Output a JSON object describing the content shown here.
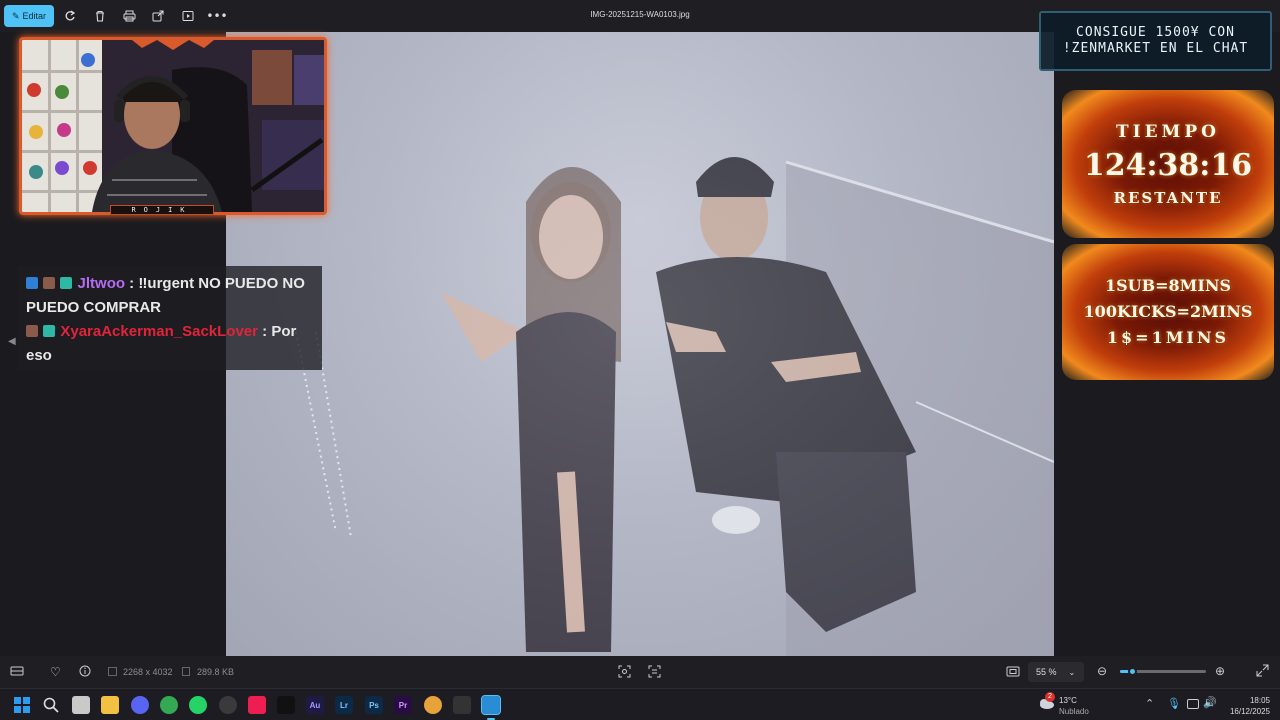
{
  "topbar": {
    "edit_label": "Editar",
    "file_name": "IMG-20251215-WA0103.jpg",
    "icons": [
      "rotate-icon",
      "delete-icon",
      "print-icon",
      "share-icon",
      "slideshow-icon",
      "more-icon"
    ]
  },
  "webcam": {
    "tag": "ROJIK"
  },
  "chat": {
    "messages": [
      {
        "user": "Jltwoo",
        "user_color": "#b36cf2",
        "separator": " : ",
        "text": "‼urgent NO PUEDO NO PUEDO COMPRAR"
      },
      {
        "user": "XyaraAckerman_SackLover",
        "user_color": "#e0243a",
        "separator": " : ",
        "text": "Por eso"
      }
    ]
  },
  "promo": {
    "line1": "CONSIGUE 1500¥ CON",
    "line2": "!ZENMARKET EN EL CHAT"
  },
  "timer": {
    "label_top": "TIEMPO",
    "time": "124:38:16",
    "label_bottom": "RESTANTE"
  },
  "rates": {
    "line1": "1SUB=8MINS",
    "line2": "100KICKS=2MINS",
    "line3": "1$=1MINS"
  },
  "bottombar": {
    "dimensions": "2268 x 4032",
    "file_size": "289.8 KB",
    "zoom": "55 %",
    "zoom_level": 0.05
  },
  "taskbar": {
    "weather_temp": "13°C",
    "weather_desc": "Nublado",
    "weather_badge": "2",
    "time": "18:05",
    "date": "16/12/2025",
    "apps": [
      {
        "name": "start-icon",
        "label": "",
        "color": "#2f9bf0"
      },
      {
        "name": "search-icon",
        "label": "",
        "color": "transparent"
      },
      {
        "name": "taskview-icon",
        "label": "",
        "color": "#c9c9c9"
      },
      {
        "name": "file-explorer-icon",
        "label": "",
        "color": "#f2c043"
      },
      {
        "name": "discord-icon",
        "label": "",
        "color": "#5865f2"
      },
      {
        "name": "chrome-icon",
        "label": "",
        "color": "#34a853"
      },
      {
        "name": "whatsapp-icon",
        "label": "",
        "color": "#25d366"
      },
      {
        "name": "obs-icon",
        "label": "",
        "color": "#3a3a3a"
      },
      {
        "name": "tiktok-icon",
        "label": "",
        "color": "#ee1d52"
      },
      {
        "name": "capcut-icon",
        "label": "",
        "color": "#111111"
      },
      {
        "name": "audition-icon",
        "label": "Au",
        "color": "#1d1a46"
      },
      {
        "name": "lightroom-icon",
        "label": "Lr",
        "color": "#0c2a45"
      },
      {
        "name": "photoshop-icon",
        "label": "Ps",
        "color": "#0c2a45"
      },
      {
        "name": "premiere-icon",
        "label": "Pr",
        "color": "#2a0c45"
      },
      {
        "name": "chrome-alt-icon",
        "label": "",
        "color": "#e8a23a"
      },
      {
        "name": "terminal-icon",
        "label": "",
        "color": "#333333"
      },
      {
        "name": "photos-icon",
        "label": "",
        "color": "#2b8cd6"
      }
    ]
  },
  "colors": {
    "accent": "#4fc3f7",
    "fire": "#f18a1d"
  }
}
